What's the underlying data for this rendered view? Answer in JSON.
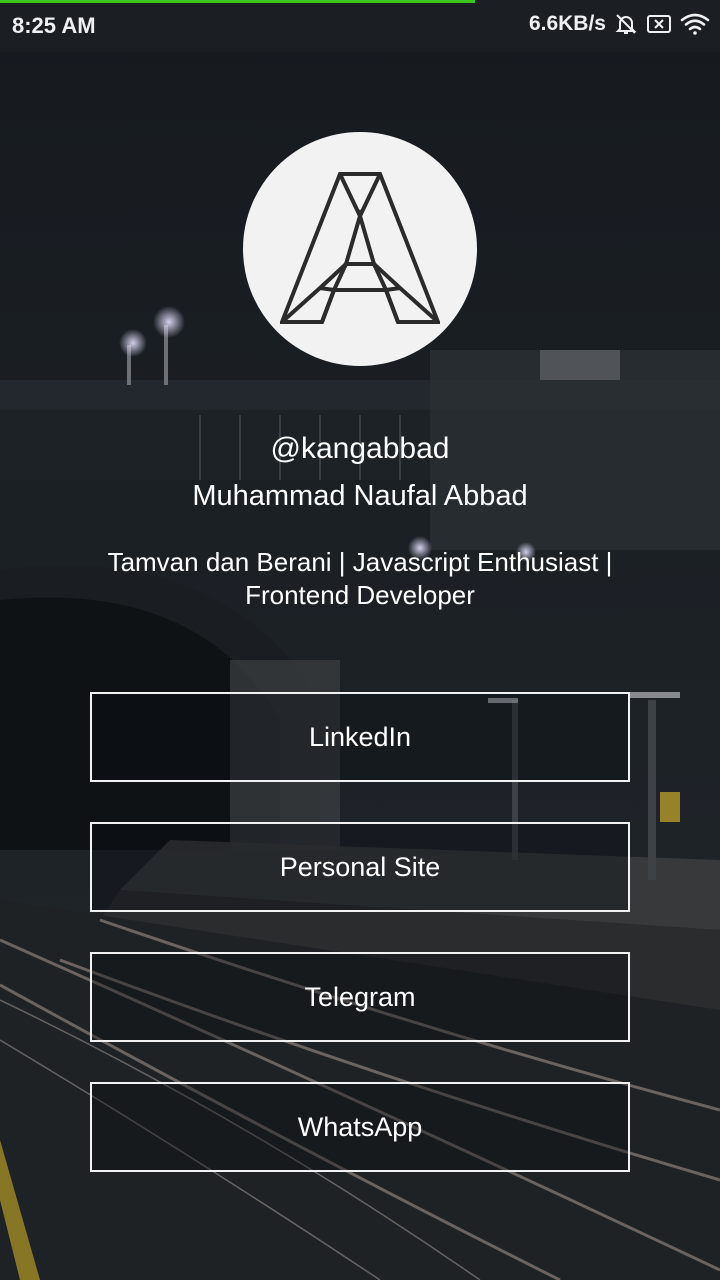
{
  "status_bar": {
    "time": "8:25 AM",
    "network_speed": "6.6KB/s",
    "icons": [
      "bell-muted-icon",
      "sim-disabled-icon",
      "wifi-icon"
    ],
    "page_load_progress_percent": 66
  },
  "profile": {
    "avatar_icon": "letter-a-logo-icon",
    "handle": "@kangabbad",
    "name": "Muhammad Naufal Abbad",
    "bio_line1": "Tamvan dan Berani | Javascript Enthusiast |",
    "bio_line2": "Frontend Developer"
  },
  "links": [
    {
      "label": "LinkedIn"
    },
    {
      "label": "Personal Site"
    },
    {
      "label": "Telegram"
    },
    {
      "label": "WhatsApp"
    }
  ],
  "colors": {
    "background": "#14181c",
    "accent_progress": "#3cc51a",
    "button_border": "#f2f2f2",
    "text": "#ffffff"
  }
}
